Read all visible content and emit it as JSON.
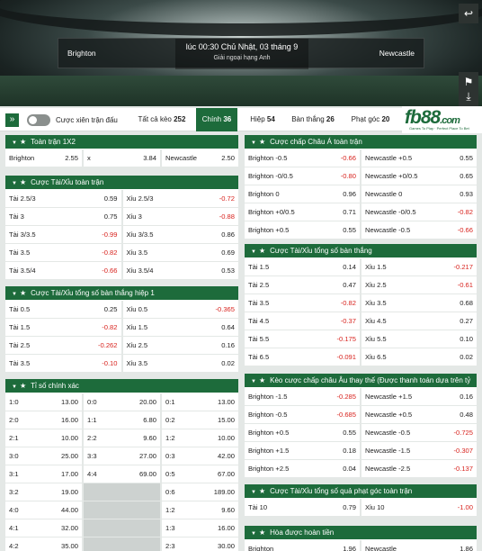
{
  "match": {
    "home": "Brighton",
    "away": "Newcastle",
    "time": "lúc 00:30 Chủ Nhật, 03 tháng 9",
    "league": "Giải ngoại hạng Anh"
  },
  "header_icons": [
    "back-icon",
    "pin-icon",
    "download-icon"
  ],
  "tabs": {
    "mix_label": "Cược xiên trận đấu",
    "items": [
      {
        "label": "Tất cả kèo",
        "count": "252"
      },
      {
        "label": "Chính",
        "count": "36"
      },
      {
        "label": "Hiệp",
        "count": "54"
      },
      {
        "label": "Bàn thắng",
        "count": "26"
      },
      {
        "label": "Phạt góc",
        "count": "20"
      }
    ]
  },
  "logo": {
    "text": "fb88",
    "suffix": ".com",
    "tagline": "Games To Play · Perfect Place To Bet"
  },
  "colors": {
    "brand": "#1d6b3b",
    "negative": "#d8241f"
  },
  "left_panels": [
    {
      "title": "Toàn trận 1X2",
      "rows": [
        [
          [
            "Brighton",
            "2.55"
          ],
          [
            "x",
            "3.84"
          ],
          [
            "Newcastle",
            "2.50"
          ]
        ]
      ]
    },
    {
      "title": "Cược Tài/Xỉu toàn trận",
      "rows": [
        [
          [
            "Tài 2.5/3",
            "0.59"
          ],
          [
            "Xỉu 2.5/3",
            "-0.72"
          ]
        ],
        [
          [
            "Tài 3",
            "0.75"
          ],
          [
            "Xỉu 3",
            "-0.88"
          ]
        ],
        [
          [
            "Tài 3/3.5",
            "-0.99"
          ],
          [
            "Xỉu 3/3.5",
            "0.86"
          ]
        ],
        [
          [
            "Tài 3.5",
            "-0.82"
          ],
          [
            "Xỉu 3.5",
            "0.69"
          ]
        ],
        [
          [
            "Tài 3.5/4",
            "-0.66"
          ],
          [
            "Xỉu 3.5/4",
            "0.53"
          ]
        ]
      ]
    },
    {
      "title": "Cược Tài/Xỉu tổng số bàn thắng hiệp 1",
      "rows": [
        [
          [
            "Tài 0.5",
            "0.25"
          ],
          [
            "Xỉu 0.5",
            "-0.365"
          ]
        ],
        [
          [
            "Tài 1.5",
            "-0.82"
          ],
          [
            "Xỉu 1.5",
            "0.64"
          ]
        ],
        [
          [
            "Tài 2.5",
            "-0.262"
          ],
          [
            "Xỉu 2.5",
            "0.16"
          ]
        ],
        [
          [
            "Tài 3.5",
            "-0.10"
          ],
          [
            "Xỉu 3.5",
            "0.02"
          ]
        ]
      ]
    },
    {
      "title": "Tỉ số chính xác",
      "rows": [
        [
          [
            "1:0",
            "13.00"
          ],
          [
            "0:0",
            "20.00"
          ],
          [
            "0:1",
            "13.00"
          ]
        ],
        [
          [
            "2:0",
            "16.00"
          ],
          [
            "1:1",
            "6.80"
          ],
          [
            "0:2",
            "15.00"
          ]
        ],
        [
          [
            "2:1",
            "10.00"
          ],
          [
            "2:2",
            "9.60"
          ],
          [
            "1:2",
            "10.00"
          ]
        ],
        [
          [
            "3:0",
            "25.00"
          ],
          [
            "3:3",
            "27.00"
          ],
          [
            "0:3",
            "42.00"
          ]
        ],
        [
          [
            "3:1",
            "17.00"
          ],
          [
            "4:4",
            "69.00"
          ],
          [
            "0:5",
            "67.00"
          ]
        ],
        [
          [
            "3:2",
            "19.00"
          ],
          null,
          [
            "0:6",
            "189.00"
          ]
        ],
        [
          [
            "4:0",
            "44.00"
          ],
          null,
          [
            "1:2",
            "9.60"
          ]
        ],
        [
          [
            "4:1",
            "32.00"
          ],
          null,
          [
            "1:3",
            "16.00"
          ]
        ],
        [
          [
            "4:2",
            "35.00"
          ],
          null,
          [
            "2:3",
            "30.00"
          ]
        ]
      ]
    }
  ],
  "right_panels": [
    {
      "title": "Cược chấp Châu Á toàn trận",
      "rows": [
        [
          [
            "Brighton -0.5",
            "-0.66"
          ],
          [
            "Newcastle +0.5",
            "0.55"
          ]
        ],
        [
          [
            "Brighton -0/0.5",
            "-0.80"
          ],
          [
            "Newcastle +0/0.5",
            "0.65"
          ]
        ],
        [
          [
            "Brighton 0",
            "0.96"
          ],
          [
            "Newcastle 0",
            "0.93"
          ]
        ],
        [
          [
            "Brighton +0/0.5",
            "0.71"
          ],
          [
            "Newcastle -0/0.5",
            "-0.82"
          ]
        ],
        [
          [
            "Brighton +0.5",
            "0.55"
          ],
          [
            "Newcastle -0.5",
            "-0.66"
          ]
        ]
      ]
    },
    {
      "title": "Cược Tài/Xỉu tổng số bàn thắng",
      "rows": [
        [
          [
            "Tài 1.5",
            "0.14"
          ],
          [
            "Xỉu 1.5",
            "-0.217"
          ]
        ],
        [
          [
            "Tài 2.5",
            "0.47"
          ],
          [
            "Xỉu 2.5",
            "-0.61"
          ]
        ],
        [
          [
            "Tài 3.5",
            "-0.82"
          ],
          [
            "Xỉu 3.5",
            "0.68"
          ]
        ],
        [
          [
            "Tài 4.5",
            "-0.37"
          ],
          [
            "Xỉu 4.5",
            "0.27"
          ]
        ],
        [
          [
            "Tài 5.5",
            "-0.175"
          ],
          [
            "Xỉu 5.5",
            "0.10"
          ]
        ],
        [
          [
            "Tài 6.5",
            "-0.091"
          ],
          [
            "Xỉu 6.5",
            "0.02"
          ]
        ]
      ]
    },
    {
      "title": "Kèo cược chấp châu Âu thay thế (Được thanh toán dựa trên tỷ",
      "rows": [
        [
          [
            "Brighton -1.5",
            "-0.285"
          ],
          [
            "Newcastle +1.5",
            "0.16"
          ]
        ],
        [
          [
            "Brighton -0.5",
            "-0.685"
          ],
          [
            "Newcastle +0.5",
            "0.48"
          ]
        ],
        [
          [
            "Brighton +0.5",
            "0.55"
          ],
          [
            "Newcastle -0.5",
            "-0.725"
          ]
        ],
        [
          [
            "Brighton +1.5",
            "0.18"
          ],
          [
            "Newcastle -1.5",
            "-0.307"
          ]
        ],
        [
          [
            "Brighton +2.5",
            "0.04"
          ],
          [
            "Newcastle -2.5",
            "-0.137"
          ]
        ]
      ]
    },
    {
      "title": "Cược Tài/Xỉu tổng số quả phạt góc toàn trận",
      "rows": [
        [
          [
            "Tài 10",
            "0.79"
          ],
          [
            "Xỉu 10",
            "-1.00"
          ]
        ]
      ]
    },
    {
      "title": "Hòa được hoàn tiền",
      "rows": [
        [
          [
            "Brighton",
            "1.96"
          ],
          [
            "Newcastle",
            "1.86"
          ]
        ]
      ]
    }
  ]
}
